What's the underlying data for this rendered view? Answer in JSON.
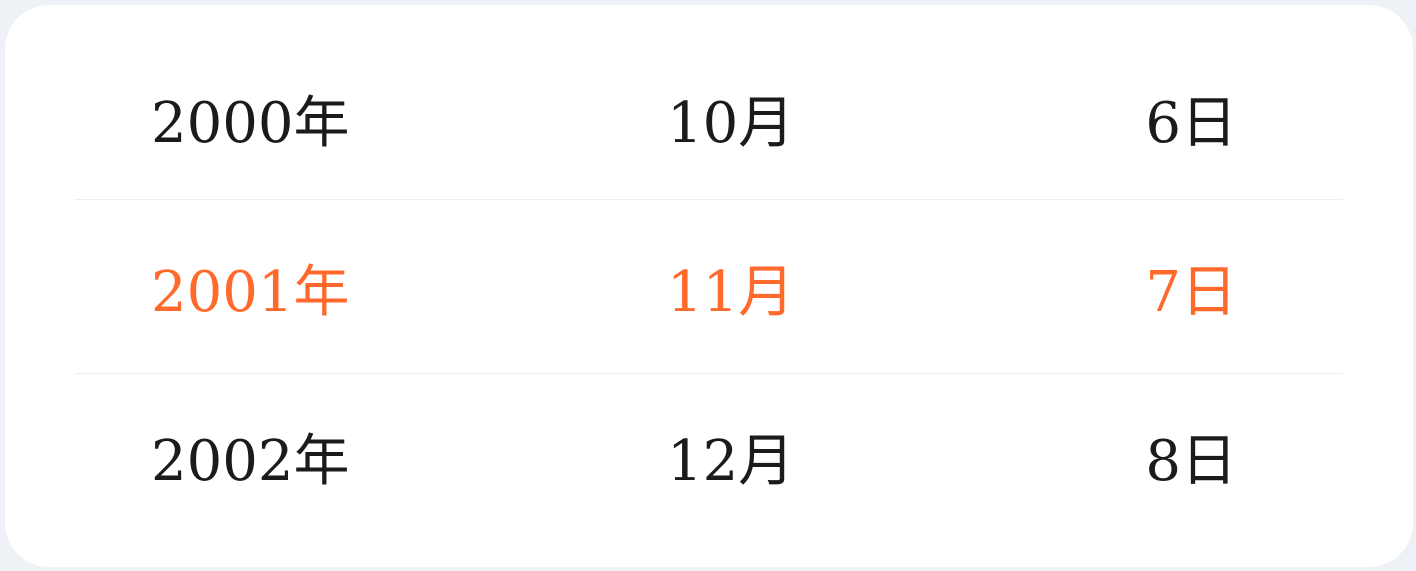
{
  "picker": {
    "accent_color": "#ff6a2c",
    "text_color": "#1b1b1b",
    "rows": [
      {
        "year": "2000年",
        "month": "10月",
        "day": "6日",
        "selected": false
      },
      {
        "year": "2001年",
        "month": "11月",
        "day": "7日",
        "selected": true
      },
      {
        "year": "2002年",
        "month": "12月",
        "day": "8日",
        "selected": false
      }
    ]
  }
}
